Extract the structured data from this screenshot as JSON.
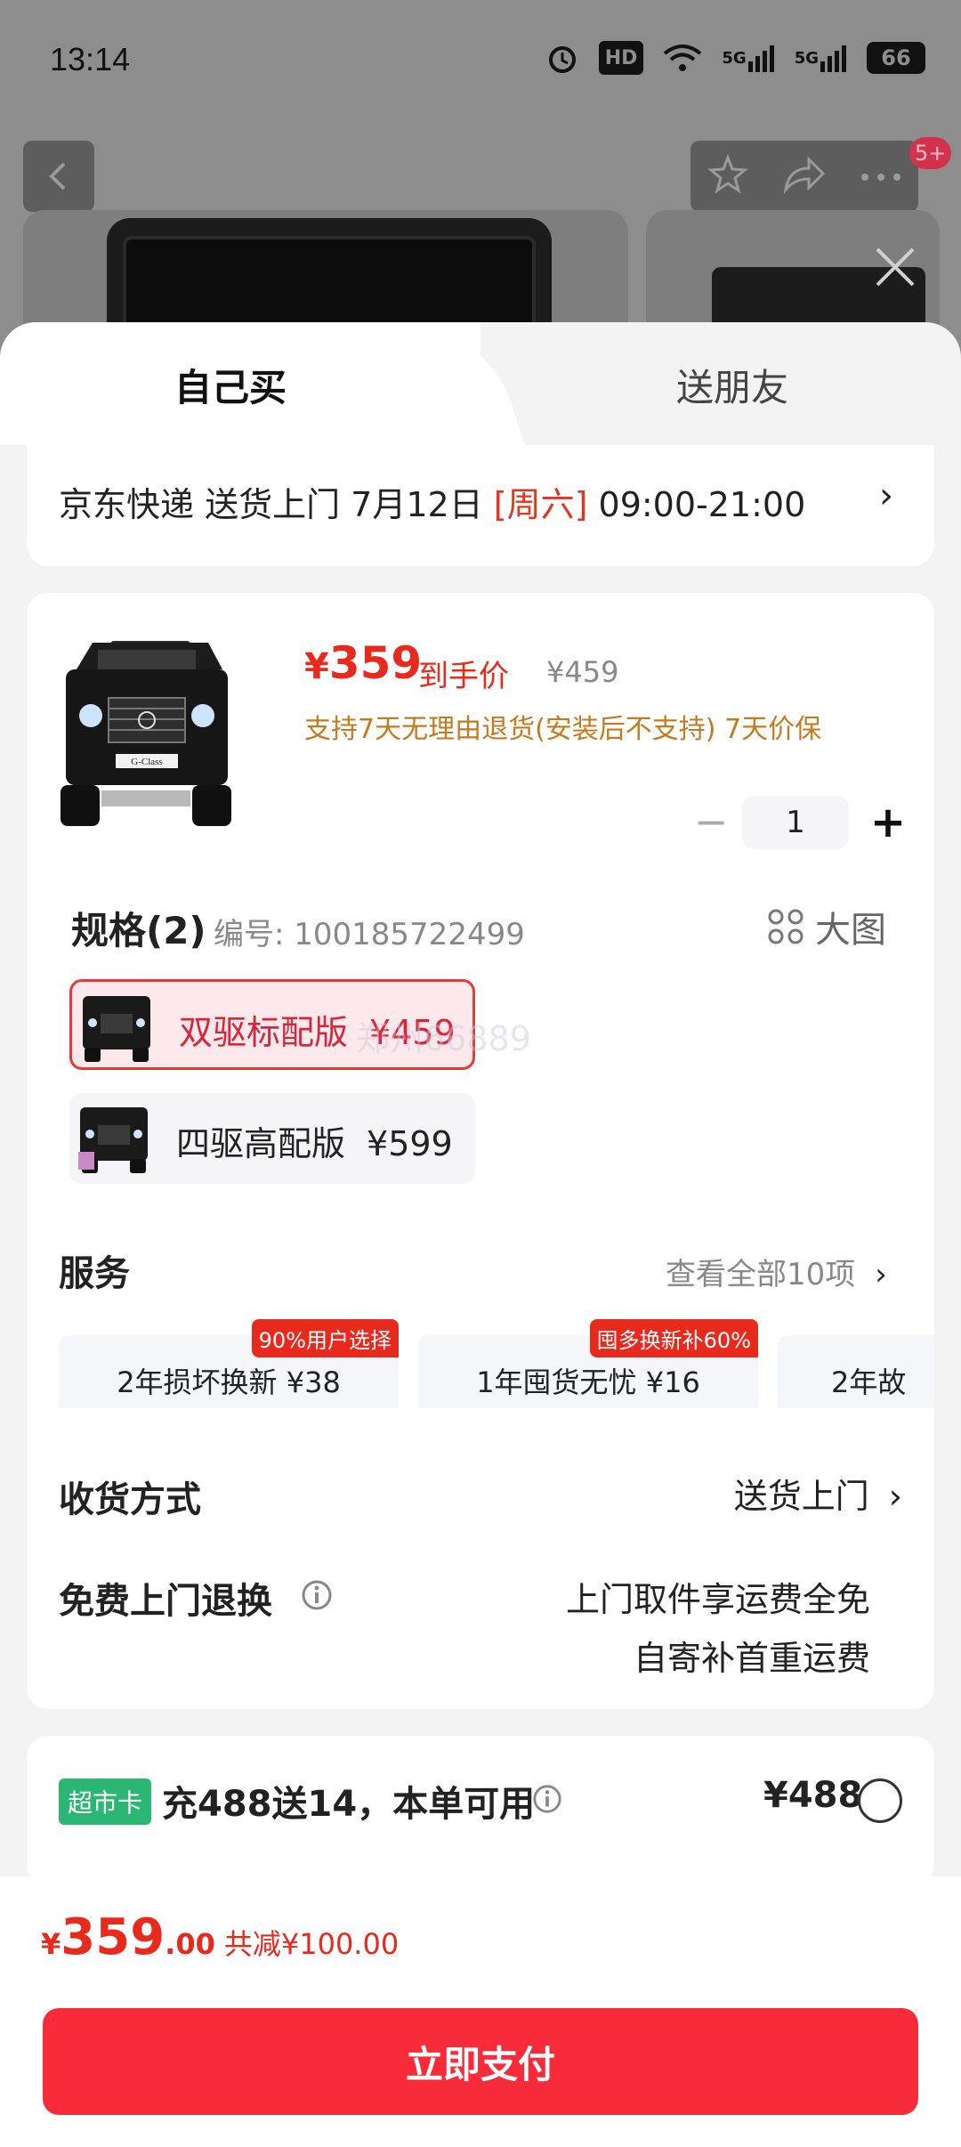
{
  "status_bar": {
    "time": "13:14",
    "hd_label": "HD",
    "net1": "5G",
    "net2": "5G",
    "battery": "66"
  },
  "background": {
    "cart_badge": "5+"
  },
  "tabs": {
    "buy_self": "自己买",
    "gift_friend": "送朋友"
  },
  "delivery": {
    "prefix": "京东快递 送货上门 7月12日 ",
    "weekday": "[周六]",
    "time_range": " 09:00-21:00"
  },
  "product": {
    "price_symbol": "¥",
    "price": "359",
    "price_tag": "到手价",
    "original_price": "¥459",
    "policy": "支持7天无理由退货(安装后不支持) 7天价保",
    "quantity": "1",
    "car_plate": "G-Class"
  },
  "spec": {
    "title": "规格(2)",
    "code": "编号: 100185722499",
    "big_pic": "大图",
    "options": [
      {
        "name": "双驱标配版",
        "price": "¥459",
        "selected": true
      },
      {
        "name": "四驱高配版",
        "price": "¥599",
        "selected": false
      }
    ],
    "watermark": "郑州66889"
  },
  "services": {
    "title": "服务",
    "view_all": "查看全部10项",
    "items": [
      {
        "label": "2年损坏换新 ¥38",
        "tag": "90%用户选择"
      },
      {
        "label": "1年囤货无忧 ¥16",
        "tag": "囤多换新补60%"
      },
      {
        "label": "2年故",
        "tag": ""
      }
    ]
  },
  "shipping": {
    "title": "收货方式",
    "value": "送货上门"
  },
  "returns": {
    "title": "免费上门退换",
    "line1": "上门取件享运费全免",
    "line2": "自寄补首重运费"
  },
  "card_offer": {
    "badge": "超市卡",
    "title": "充488送14，本单可用",
    "price": "¥488"
  },
  "footer": {
    "symbol": "¥",
    "int": "359",
    "dec": ".00",
    "saving": "共减¥100.00",
    "pay_button": "立即支付"
  },
  "colors": {
    "accent_red": "#e8291c",
    "pay_button": "#f72b3a",
    "policy_orange": "#c57a1e",
    "card_green": "#2bb673"
  }
}
